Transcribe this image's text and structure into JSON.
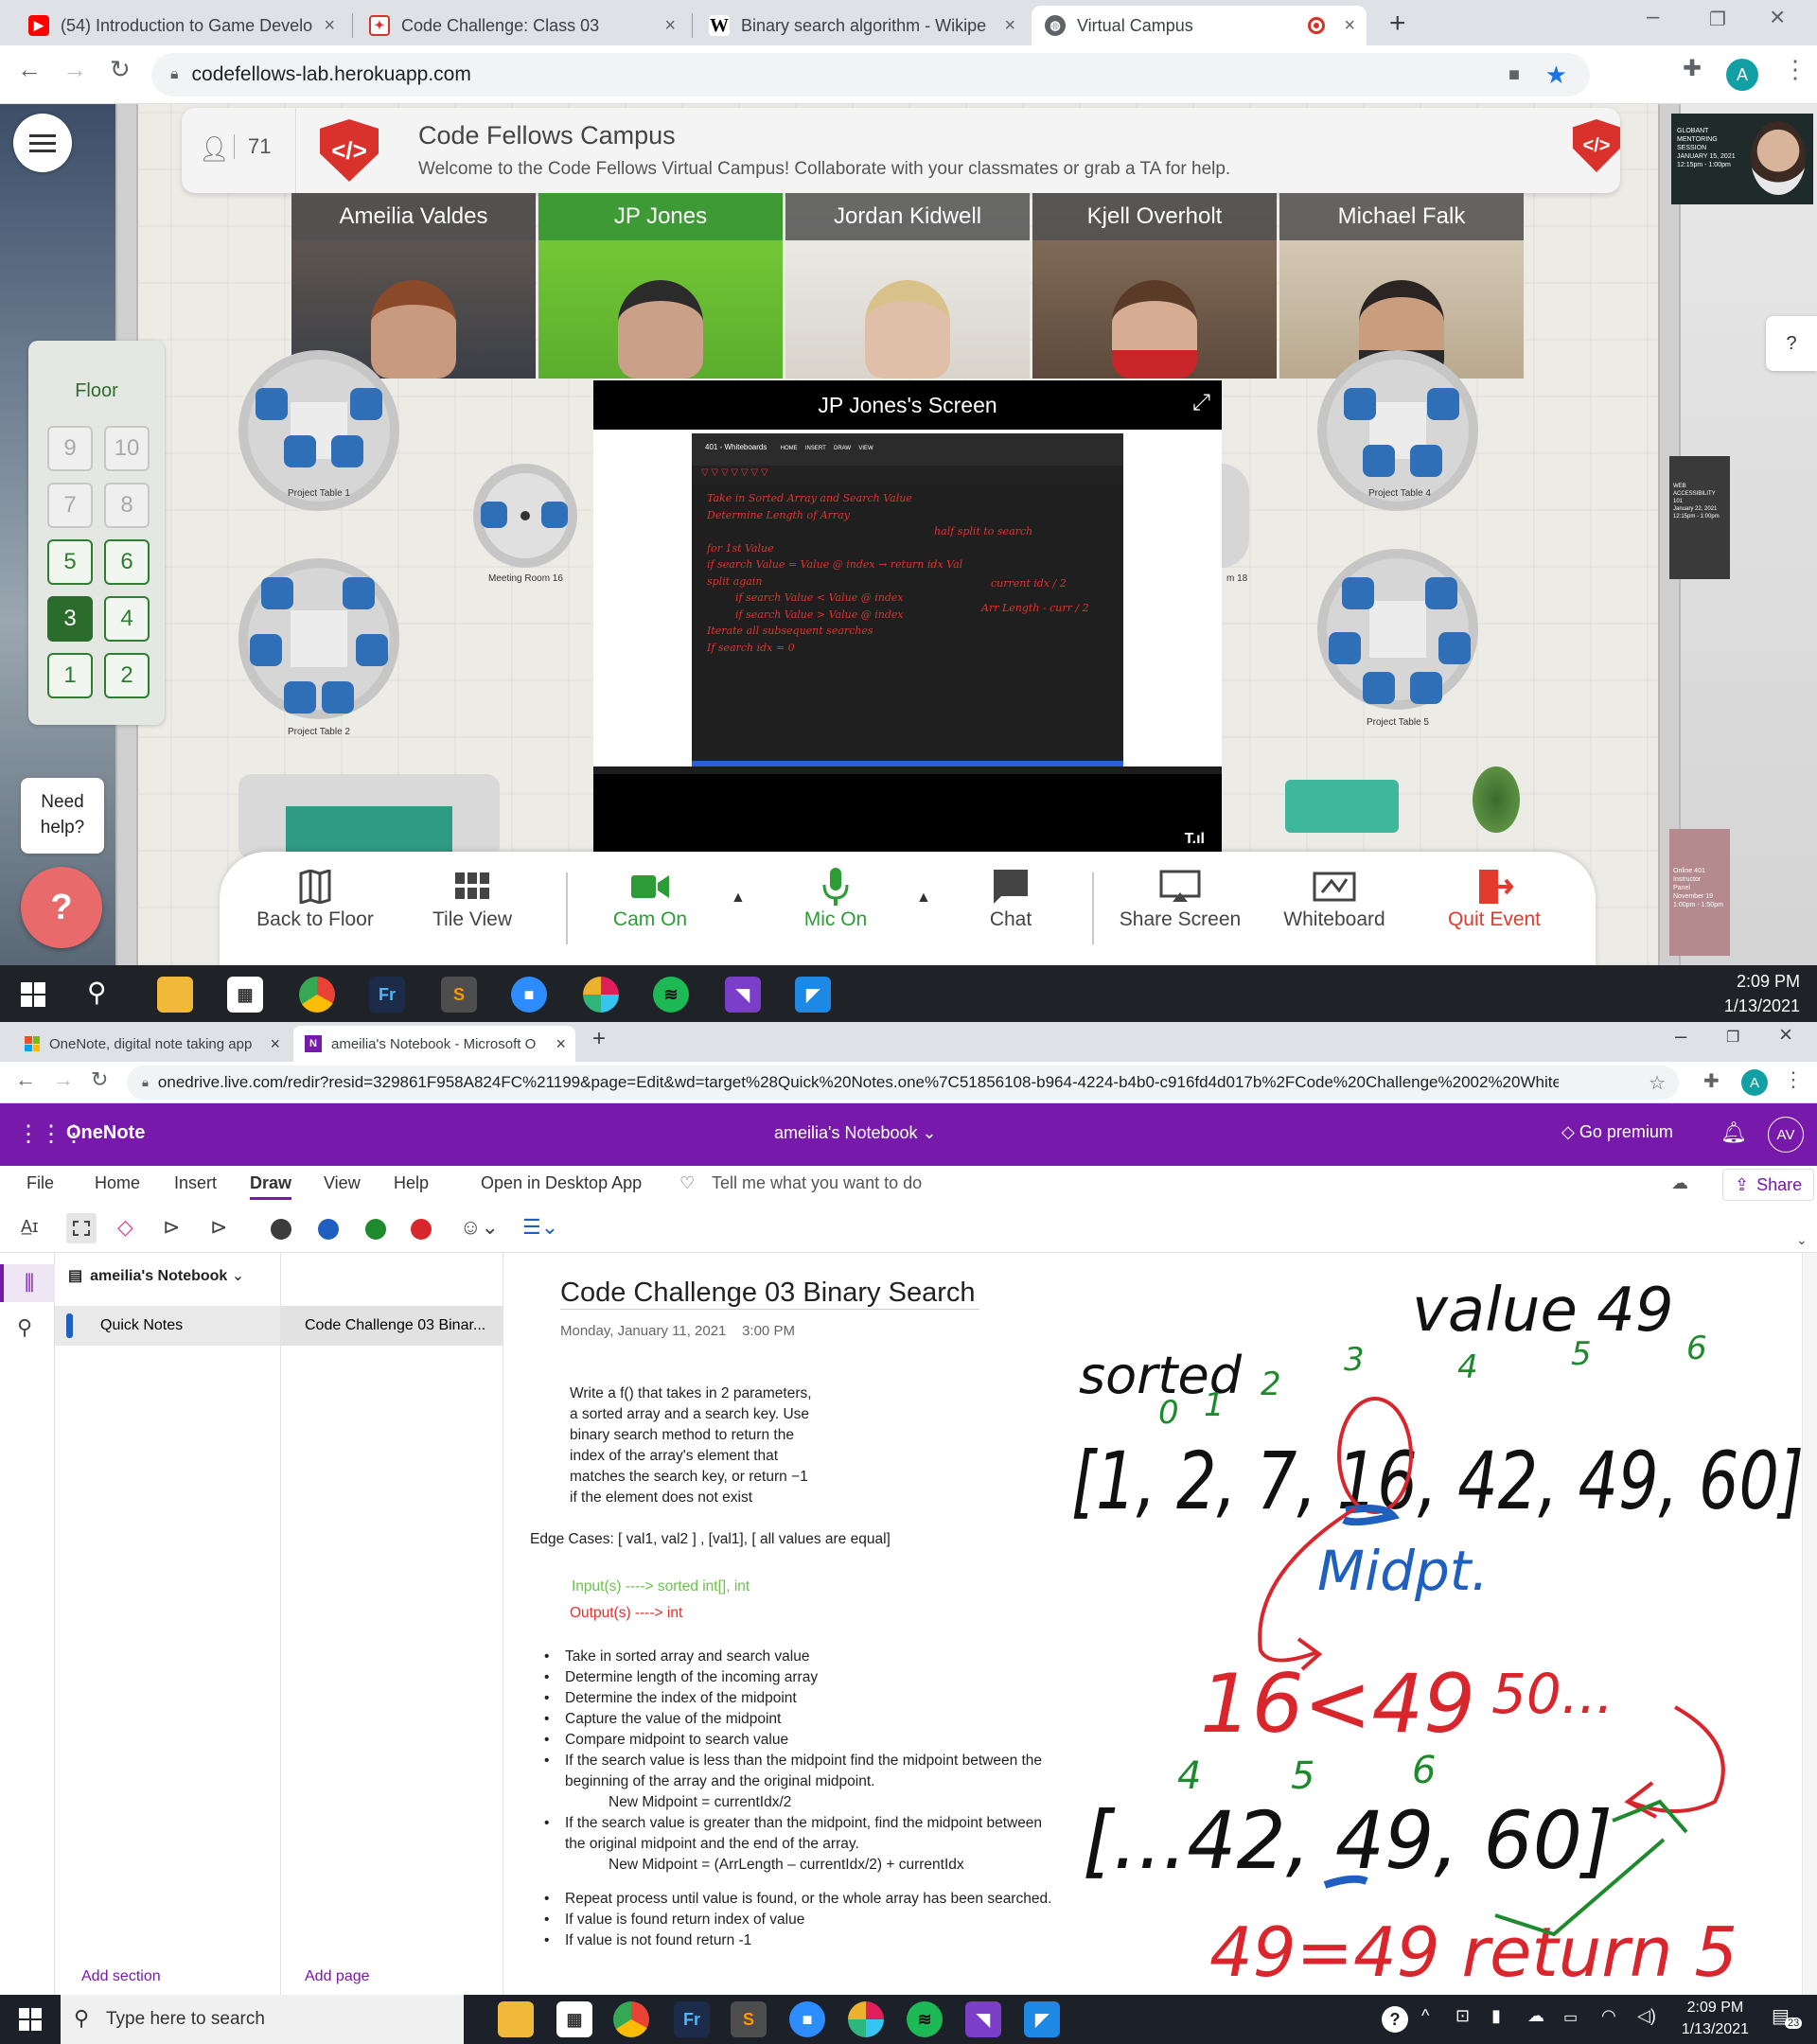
{
  "browser1": {
    "tabs": [
      {
        "label": "(54) Introduction to Game Develo",
        "icon": "youtube-icon"
      },
      {
        "label": "Code Challenge: Class 03",
        "icon": "codefellows-icon"
      },
      {
        "label": "Binary search algorithm - Wikipe",
        "icon": "wikipedia-icon"
      },
      {
        "label": "Virtual Campus",
        "icon": "globe-icon"
      }
    ],
    "url": "codefellows-lab.herokuapp.com",
    "avatar_letter": "A"
  },
  "campus": {
    "user_count": "71",
    "title": "Code Fellows Campus",
    "subtitle": "Welcome to the Code Fellows Virtual Campus! Collaborate with your classmates or grab a TA for help.",
    "participants": [
      {
        "name": "Ameilia Valdes",
        "speaking": false
      },
      {
        "name": "JP Jones",
        "speaking": true
      },
      {
        "name": "Jordan Kidwell",
        "speaking": false
      },
      {
        "name": "Kjell Overholt",
        "speaking": false
      },
      {
        "name": "Michael Falk",
        "speaking": false
      }
    ],
    "floor": {
      "title": "Floor",
      "buttons": [
        {
          "label": "9",
          "enabled": false
        },
        {
          "label": "10",
          "enabled": false
        },
        {
          "label": "7",
          "enabled": false
        },
        {
          "label": "8",
          "enabled": false
        },
        {
          "label": "5",
          "enabled": true
        },
        {
          "label": "6",
          "enabled": true
        },
        {
          "label": "3",
          "enabled": true,
          "selected": true
        },
        {
          "label": "4",
          "enabled": true
        },
        {
          "label": "1",
          "enabled": true
        },
        {
          "label": "2",
          "enabled": true
        }
      ]
    },
    "rooms": [
      "Project Table 1",
      "Meeting Room 16",
      "Project Table 2",
      "Project Table 4",
      "Project Table 5",
      "m 18"
    ],
    "screen_share_title": "JP Jones's Screen",
    "whiteboard_app_title": "401 - Whiteboards",
    "whiteboard_tabs": [
      "HOME",
      "INSERT",
      "DRAW",
      "VIEW"
    ],
    "whiteboard_lines": [
      "Take in Sorted Array and Search Value",
      "Determine Length of Array",
      "half split to search",
      "for 1st Value",
      "if search Value = Value @ index → return idx Val",
      "split again",
      "if search Value < Value @ index",
      "if search Value > Value @ index",
      "current idx / 2",
      "Arr Length - curr / 2",
      "Iterate all subsequent searches",
      "If search idx = 0"
    ],
    "help_question": "?",
    "need_help": "Need help?",
    "toolbar": [
      {
        "label": "Back to Floor",
        "icon": "map-icon",
        "color": "#444444"
      },
      {
        "label": "Tile View",
        "icon": "grid-icon",
        "color": "#444444"
      },
      {
        "label": "Cam On",
        "icon": "camera-icon",
        "color": "#2e9c36"
      },
      {
        "label": "Mic On",
        "icon": "mic-icon",
        "color": "#2e9c36"
      },
      {
        "label": "Chat",
        "icon": "chat-icon",
        "color": "#444444"
      },
      {
        "label": "Share Screen",
        "icon": "share-screen-icon",
        "color": "#444444"
      },
      {
        "label": "Whiteboard",
        "icon": "whiteboard-icon",
        "color": "#444444"
      },
      {
        "label": "Quit Event",
        "icon": "quit-icon",
        "color": "#e23b2e"
      }
    ],
    "posters": [
      {
        "lines": [
          "GLOBANT",
          "MENTORING",
          "SESSION",
          "JANUARY 15, 2021",
          "12:15pm - 1:00pm"
        ]
      },
      {
        "lines": [
          "WEB",
          "ACCESSIBILITY",
          "101",
          "January 22, 2021",
          "12:15pm - 1:00pm"
        ]
      },
      {
        "lines": [
          "Online 401",
          "Instructor",
          "Panel",
          "November 19",
          "1:00pm - 1:50pm"
        ]
      }
    ]
  },
  "taskbar1": {
    "time": "2:09 PM",
    "date": "1/13/2021"
  },
  "browser2": {
    "tabs": [
      {
        "label": "OneNote, digital note taking app",
        "icon": "microsoft-icon"
      },
      {
        "label": "ameilia's Notebook - Microsoft O",
        "icon": "onenote-icon"
      }
    ],
    "url": "onedrive.live.com/redir?resid=329861F958A824FC%21199&page=Edit&wd=target%28Quick%20Notes.one%7C51856108-b964-4224-b4b0-c916fd4d017b%2FCode%20Challenge%2002%20WhiteBoar...",
    "avatar_letter": "A"
  },
  "onenote": {
    "app_name": "OneNote",
    "notebook_title": "ameilia's Notebook",
    "go_premium": "Go premium",
    "user_initials": "AV",
    "menu": [
      "File",
      "Home",
      "Insert",
      "Draw",
      "View",
      "Help",
      "Open in Desktop App"
    ],
    "active_menu": "Draw",
    "tell_me": "Tell me what you want to do",
    "share": "Share",
    "pen_colors": [
      "#3c3c3c",
      "#1f5fbf",
      "#1e8a2d",
      "#d9252c"
    ],
    "notebook_name": "ameilia's Notebook",
    "section": "Quick Notes",
    "page": "Code Challenge 03 Binar...",
    "add_section": "Add section",
    "add_page": "Add page",
    "page_title": "Code Challenge 03 Binary Search",
    "page_date": "Monday, January 11, 2021",
    "page_time": "3:00 PM",
    "problem": [
      "Write a f() that takes in 2 parameters,",
      "a sorted array and a search key. Use",
      "binary search method to return the",
      "index of the array's element that",
      "matches the search key, or return −1",
      "if the element does not exist"
    ],
    "edge_cases": "Edge Cases: [ val1, val2 ] , [val1], [ all values are equal]",
    "input": "Input(s) ----> sorted int[], int",
    "output": "Output(s) ----> int",
    "steps": [
      {
        "text": "Take in sorted array and search value"
      },
      {
        "text": "Determine length of the incoming array"
      },
      {
        "text": "Determine the index of the midpoint"
      },
      {
        "text": "Capture the value of the midpoint"
      },
      {
        "text": "Compare midpoint to search value"
      },
      {
        "text": "If the search value is less than the midpoint find the midpoint between the beginning of the array and the original midpoint.",
        "sub": "New Midpoint = currentIdx/2"
      },
      {
        "text": "If the search value is greater than the midpoint, find the midpoint between the original midpoint and the end of the array.",
        "sub": "New Midpoint = (ArrLength – currentIdx/2) + currentIdx"
      }
    ],
    "steps2": [
      "Repeat process until value is found, or the whole array has been searched.",
      "If value is found return index of value",
      "If value is not found return -1"
    ],
    "ink": {
      "value_label": "value 49",
      "sorted_label": "sorted",
      "array1": "[1, 2, 7, 16, 42, 49, 60]",
      "indices1": [
        "0",
        "1",
        "2",
        "3",
        "4",
        "5",
        "6"
      ],
      "midpt": "Midpt.",
      "compare": "16<49",
      "ellipsis": "50...",
      "array2": "[...42, 49, 60]",
      "indices2": [
        "4",
        "5",
        "6"
      ],
      "result": "49=49 return 5"
    }
  },
  "taskbar2": {
    "search_placeholder": "Type here to search",
    "time": "2:09 PM",
    "date": "1/13/2021",
    "notifications": "23"
  }
}
